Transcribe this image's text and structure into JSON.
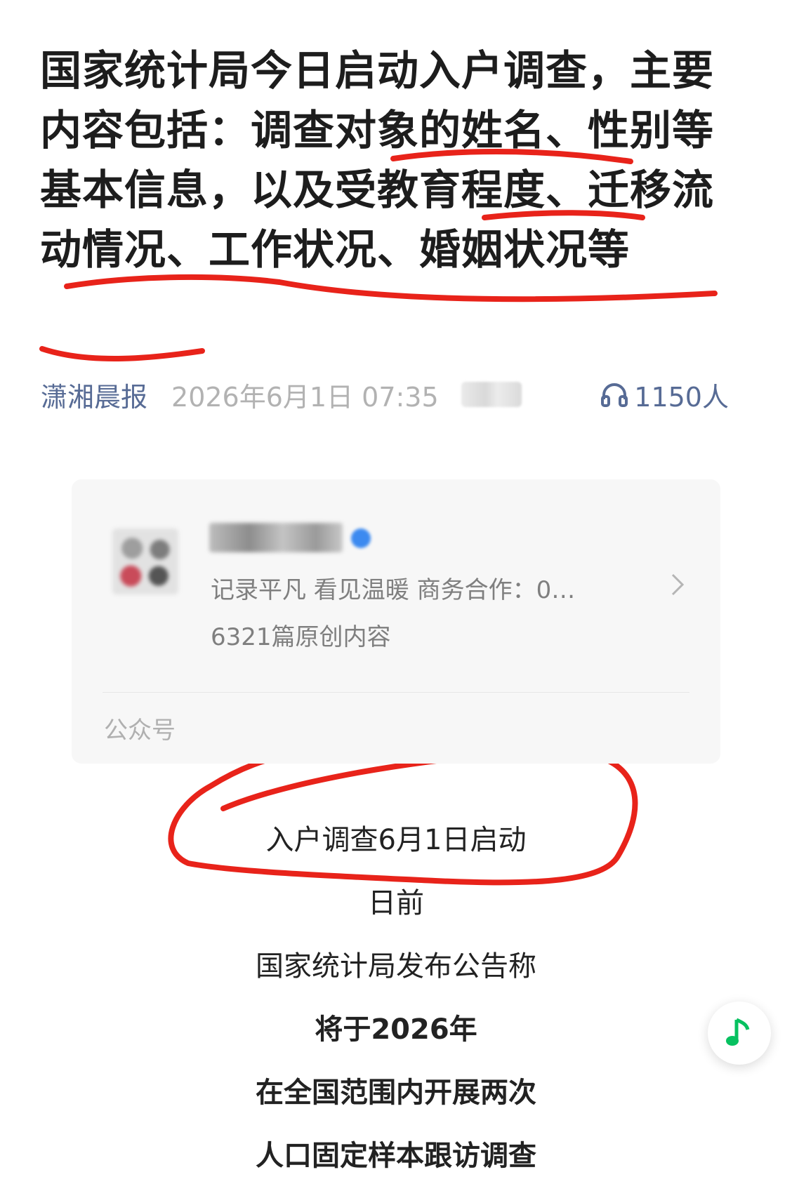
{
  "article": {
    "title": "国家统计局今日启动入户调查，主要内容包括：调查对象的姓名、性别等基本信息，以及受教育程度、迁移流动情况、工作状况、婚姻状况等"
  },
  "meta": {
    "source": "潇湘晨报",
    "publish_time": "2026年6月1日 07:35",
    "listen_count": "1150人",
    "listen_icon": "headphones-icon"
  },
  "account_card": {
    "description": "记录平凡 看见温暖 商务合作：0…",
    "article_count": "6321篇原创内容",
    "account_type": "公众号",
    "verified_icon": "verified-icon",
    "chevron_icon": "chevron-right-icon"
  },
  "body": {
    "lines": [
      "入户调查6月1日启动",
      "日前",
      "国家统计局发布公告称",
      "将于2026年",
      "在全国范围内开展两次",
      "人口固定样本跟访调查"
    ]
  },
  "music_button": {
    "icon": "music-note-icon"
  },
  "colors": {
    "link": "#576b95",
    "annotation": "#e8231a",
    "music": "#07c160",
    "muted": "#b2b2b2"
  }
}
